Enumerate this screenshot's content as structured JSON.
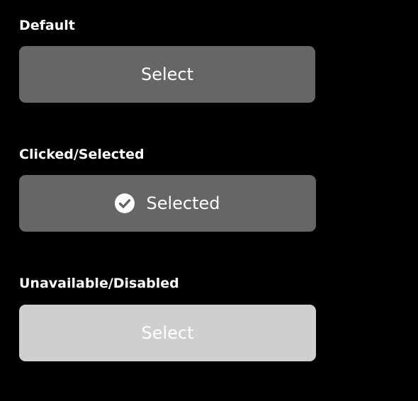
{
  "colors": {
    "background": "#000000",
    "button_fill": "#666666",
    "button_disabled_fill": "#CFCFCF",
    "text": "#FFFFFF"
  },
  "sections": {
    "default": {
      "label": "Default",
      "button_label": "Select"
    },
    "selected": {
      "label": "Clicked/Selected",
      "button_label": "Selected",
      "icon": "check-circle-icon"
    },
    "disabled": {
      "label": "Unavailable/Disabled",
      "button_label": "Select"
    }
  }
}
